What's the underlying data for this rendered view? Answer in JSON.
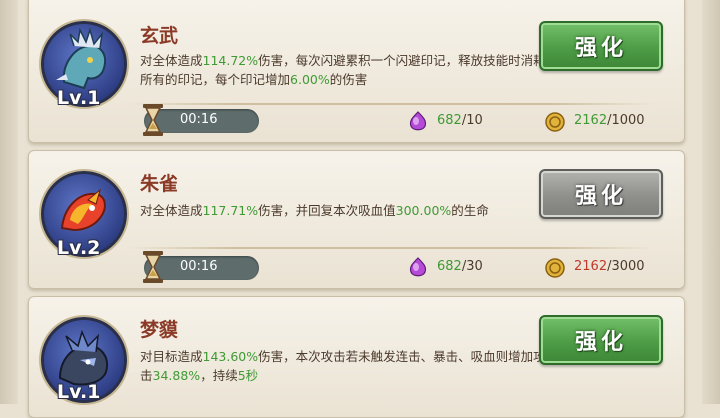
{
  "cards": [
    {
      "name": "玄武",
      "level_label": "Lv.1",
      "description": [
        "对全体造成",
        "114.72%",
        "伤害，每次闪避累积一个闪避印记，释放技能时消耗所有的印记，每个印记增加",
        "6.00%",
        "的伤害"
      ],
      "button_label": "强化",
      "button_state": "enabled",
      "timer": "00:16",
      "gem": {
        "have": "682",
        "need": "10"
      },
      "coin": {
        "have": "2162",
        "need": "1000"
      },
      "avatar_icon": "azure-dragon-icon"
    },
    {
      "name": "朱雀",
      "level_label": "Lv.2",
      "description": [
        "对全体造成",
        "117.71%",
        "伤害，并回复本次吸血值",
        "300.00%",
        "的生命"
      ],
      "button_label": "强化",
      "button_state": "disabled",
      "timer": "00:16",
      "gem": {
        "have": "682",
        "need": "30"
      },
      "coin": {
        "have": "2162",
        "need": "3000"
      },
      "avatar_icon": "vermilion-bird-icon"
    },
    {
      "name": "梦貘",
      "level_label": "Lv.1",
      "description": [
        "对目标造成",
        "143.60%",
        "伤害，本次攻击若未触发连击、暴击、吸血则增加攻击",
        "34.88%",
        "，持续",
        "5秒"
      ],
      "button_label": "强化",
      "button_state": "enabled",
      "avatar_icon": "dream-tapir-icon"
    }
  ],
  "colors": {
    "highlight": "#3f9a34",
    "insufficient": "#c0392b",
    "name": "#8a3a26",
    "button_green": "#4e9c46",
    "button_gray": "#8f8f8c"
  }
}
